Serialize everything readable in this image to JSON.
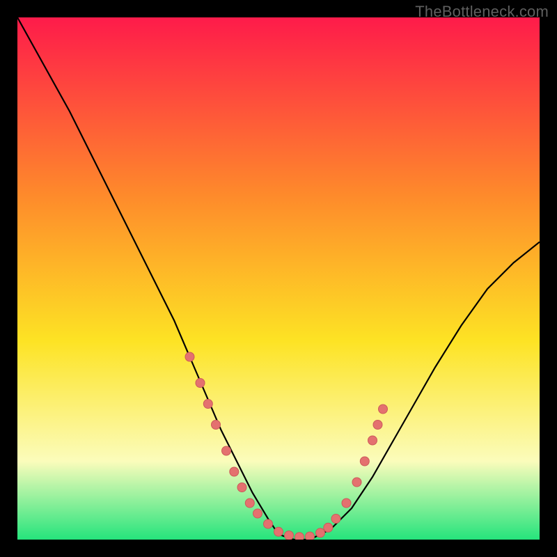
{
  "watermark": "TheBottleneck.com",
  "colors": {
    "bg": "#000000",
    "grad_top": "#fe1b4a",
    "grad_mid1": "#fe8a2b",
    "grad_mid2": "#fde324",
    "grad_low": "#fbfcbb",
    "grad_bottom": "#25e47c",
    "curve": "#000000",
    "dot_fill": "#e4716f",
    "dot_stroke": "#cc5a5a"
  },
  "chart_data": {
    "type": "line",
    "title": "",
    "xlabel": "",
    "ylabel": "",
    "xlim": [
      0,
      100
    ],
    "ylim": [
      0,
      100
    ],
    "grid": false,
    "legend": false,
    "series": [
      {
        "name": "bottleneck-curve",
        "x": [
          0,
          5,
          10,
          15,
          20,
          25,
          30,
          33,
          36,
          39,
          42,
          45,
          48,
          50,
          53,
          56,
          60,
          64,
          68,
          72,
          76,
          80,
          85,
          90,
          95,
          100
        ],
        "y": [
          100,
          91,
          82,
          72,
          62,
          52,
          42,
          35,
          28,
          21,
          15,
          9,
          4,
          1,
          0,
          0,
          2,
          6,
          12,
          19,
          26,
          33,
          41,
          48,
          53,
          57
        ]
      }
    ],
    "points": [
      {
        "x": 33,
        "y": 35
      },
      {
        "x": 35,
        "y": 30
      },
      {
        "x": 36.5,
        "y": 26
      },
      {
        "x": 38,
        "y": 22
      },
      {
        "x": 40,
        "y": 17
      },
      {
        "x": 41.5,
        "y": 13
      },
      {
        "x": 43,
        "y": 10
      },
      {
        "x": 44.5,
        "y": 7
      },
      {
        "x": 46,
        "y": 5
      },
      {
        "x": 48,
        "y": 3
      },
      {
        "x": 50,
        "y": 1.5
      },
      {
        "x": 52,
        "y": 0.8
      },
      {
        "x": 54,
        "y": 0.5
      },
      {
        "x": 56,
        "y": 0.6
      },
      {
        "x": 58,
        "y": 1.3
      },
      {
        "x": 59.5,
        "y": 2.3
      },
      {
        "x": 61,
        "y": 4
      },
      {
        "x": 63,
        "y": 7
      },
      {
        "x": 65,
        "y": 11
      },
      {
        "x": 66.5,
        "y": 15
      },
      {
        "x": 68,
        "y": 19
      },
      {
        "x": 69,
        "y": 22
      },
      {
        "x": 70,
        "y": 25
      }
    ]
  }
}
